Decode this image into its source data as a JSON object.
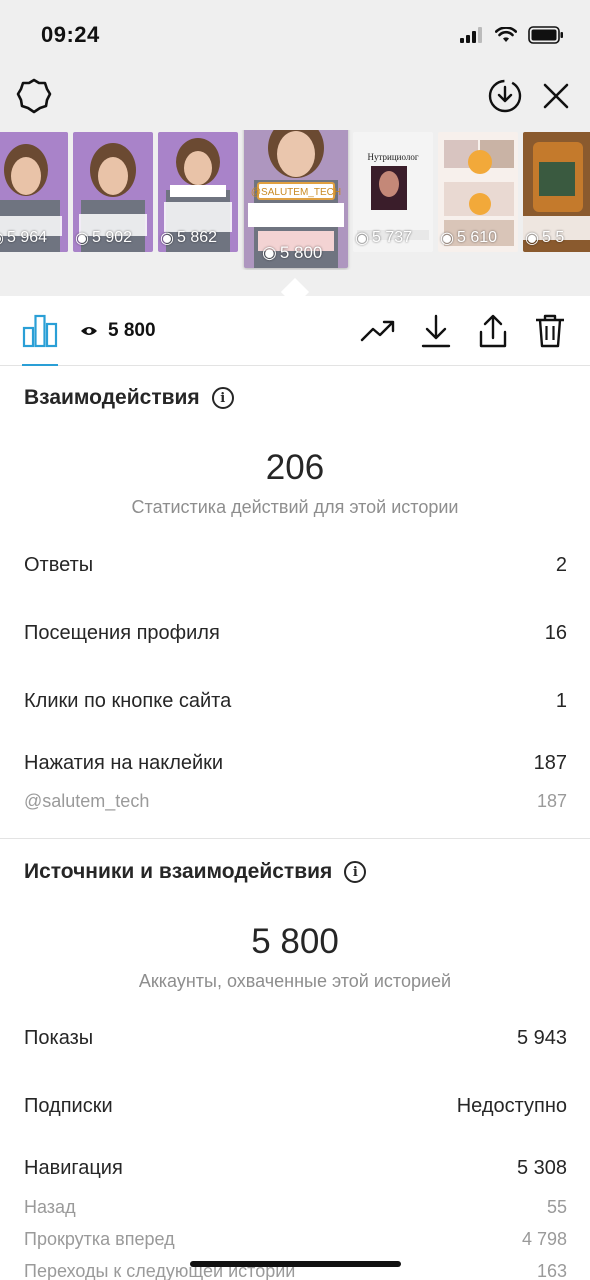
{
  "status_bar": {
    "time": "09:24"
  },
  "stories": [
    {
      "views": "5 964",
      "label": ""
    },
    {
      "views": "5 902",
      "label": ""
    },
    {
      "views": "5 862",
      "label": "@SALUTEM_TECH"
    },
    {
      "views": "5 800",
      "label": "@SALUTEM_TECH",
      "selected": true
    },
    {
      "views": "5 737",
      "label": "Нутрициолог"
    },
    {
      "views": "5 610",
      "label": ""
    },
    {
      "views": "5 5",
      "label": ""
    }
  ],
  "action_bar": {
    "view_count": "5 800"
  },
  "interactions": {
    "title": "Взаимодействия",
    "total": "206",
    "caption": "Статистика действий для этой истории",
    "rows": [
      {
        "label": "Ответы",
        "value": "2"
      },
      {
        "label": "Посещения профиля",
        "value": "16"
      },
      {
        "label": "Клики по кнопке сайта",
        "value": "1"
      },
      {
        "label": "Нажатия на наклейки",
        "value": "187"
      }
    ],
    "sticker_sub": {
      "label": "@salutem_tech",
      "value": "187"
    }
  },
  "reach": {
    "title": "Источники и взаимодействия",
    "total": "5 800",
    "caption": "Аккаунты, охваченные этой историей",
    "rows": [
      {
        "label": "Показы",
        "value": "5 943"
      },
      {
        "label": "Подписки",
        "value": "Недоступно"
      },
      {
        "label": "Навигация",
        "value": "5 308"
      }
    ],
    "nav_sub": [
      {
        "label": "Назад",
        "value": "55"
      },
      {
        "label": "Прокрутка вперед",
        "value": "4 798"
      },
      {
        "label": "Переходы к следующей истории",
        "value": "163"
      }
    ]
  },
  "colors": {
    "accent": "#2a9fd6",
    "text": "#262626",
    "muted": "#8e8e8e",
    "bar_bg": "#efefef"
  }
}
